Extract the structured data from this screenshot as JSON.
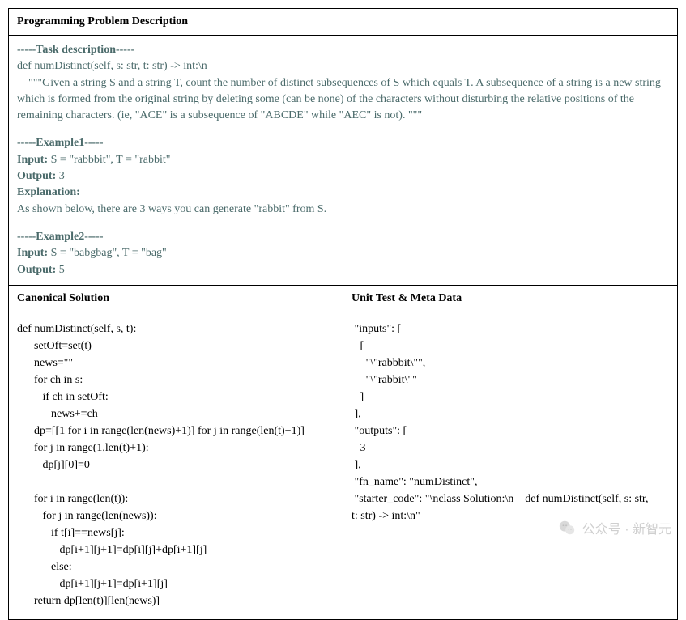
{
  "header": {
    "title": "Programming Problem Description"
  },
  "description": {
    "task_marker": "-----Task description-----",
    "signature": "def numDistinct(self, s: str, t: str) -> int:\\n",
    "docstring": "\"\"\"Given a string S and a string T, count the number of distinct subsequences of S which equals T. A subsequence of a string is a new string which is formed from the original string by deleting some (can be none) of the characters without disturbing the relative positions of the remaining characters. (ie, \"ACE\" is a subsequence of \"ABCDE\" while \"AEC\" is not). \"\"\"",
    "example1_marker": "-----Example1-----",
    "example1_input_label": "Input:",
    "example1_input_value": " S = \"rabbbit\", T = \"rabbit\"",
    "example1_output_label": "Output:",
    "example1_output_value": " 3",
    "example1_expl_label": "Explanation:",
    "example1_expl_text": "As shown below, there are 3 ways you can generate \"rabbit\" from S.",
    "example2_marker": "-----Example2-----",
    "example2_input_label": "Input:",
    "example2_input_value": " S = \"babgbag\", T = \"bag\"",
    "example2_output_label": "Output:",
    "example2_output_value": " 5"
  },
  "subheads": {
    "left": "Canonical Solution",
    "right": "Unit Test & Meta Data"
  },
  "solution_code": "def numDistinct(self, s, t):\n      setOft=set(t)\n      news=\"\"\n      for ch in s:\n         if ch in setOft:\n            news+=ch\n      dp=[[1 for i in range(len(news)+1)] for j in range(len(t)+1)]\n      for j in range(1,len(t)+1):\n         dp[j][0]=0\n\n      for i in range(len(t)):\n         for j in range(len(news)):\n            if t[i]==news[j]:\n               dp[i+1][j+1]=dp[i][j]+dp[i+1][j]\n            else:\n               dp[i+1][j+1]=dp[i+1][j]\n      return dp[len(t)][len(news)]",
  "unit_test": " \"inputs\": [\n   [\n     \"\\\"rabbbit\\\"\",\n     \"\\\"rabbit\\\"\"\n   ]\n ],\n \"outputs\": [\n   3\n ],\n \"fn_name\": \"numDistinct\",\n \"starter_code\": \"\\nclass Solution:\\n    def numDistinct(self, s: str,\nt: str) -> int:\\n\"",
  "watermark": {
    "text": "公众号 · 新智元"
  }
}
